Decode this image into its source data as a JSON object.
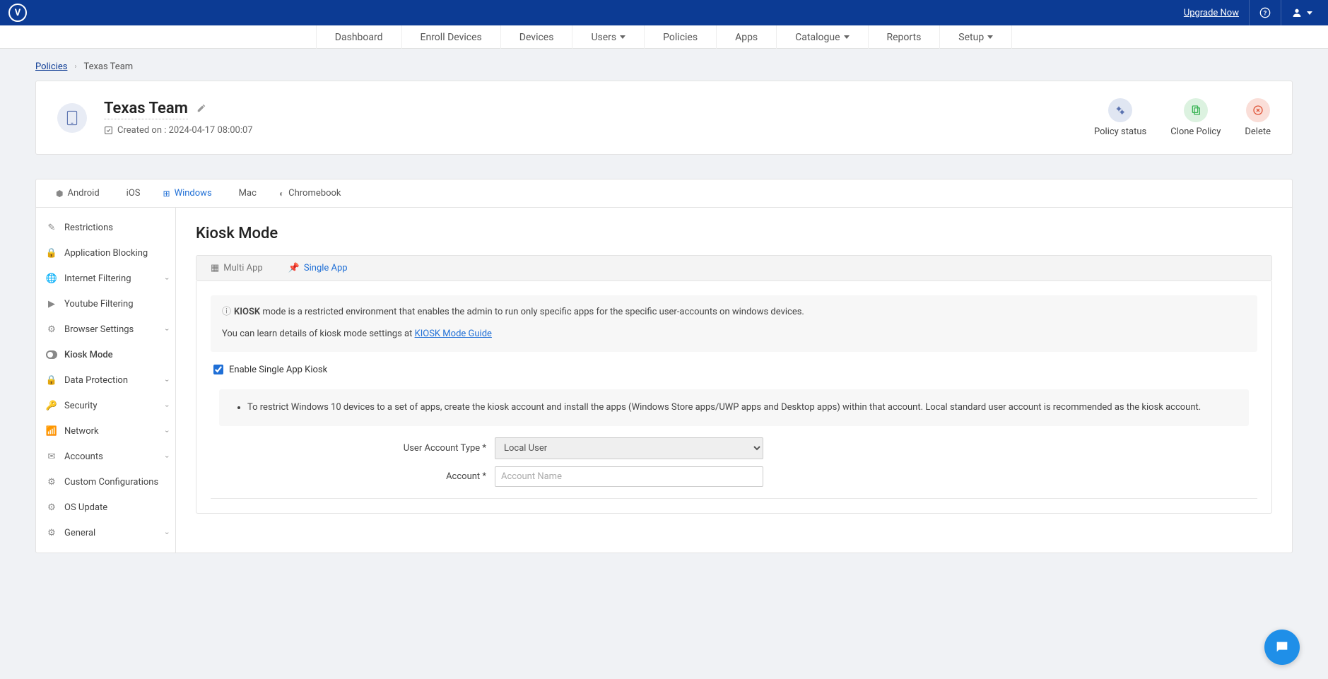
{
  "topbar": {
    "upgrade": "Upgrade Now"
  },
  "nav": {
    "dashboard": "Dashboard",
    "enroll": "Enroll Devices",
    "devices": "Devices",
    "users": "Users",
    "policies": "Policies",
    "apps": "Apps",
    "catalogue": "Catalogue",
    "reports": "Reports",
    "setup": "Setup"
  },
  "breadcrumb": {
    "root": "Policies",
    "current": "Texas Team"
  },
  "policy": {
    "title": "Texas Team",
    "created_label": "Created on : 2024-04-17 08:00:07",
    "actions": {
      "status": "Policy status",
      "clone": "Clone Policy",
      "delete": "Delete"
    }
  },
  "os_tabs": {
    "android": "Android",
    "ios": "iOS",
    "windows": "Windows",
    "mac": "Mac",
    "chromebook": "Chromebook"
  },
  "sidebar": {
    "restrictions": "Restrictions",
    "app_blocking": "Application Blocking",
    "internet_filtering": "Internet Filtering",
    "youtube_filtering": "Youtube Filtering",
    "browser_settings": "Browser Settings",
    "kiosk_mode": "Kiosk Mode",
    "data_protection": "Data Protection",
    "security": "Security",
    "network": "Network",
    "accounts": "Accounts",
    "custom_config": "Custom Configurations",
    "os_update": "OS Update",
    "general": "General"
  },
  "panel": {
    "title": "Kiosk Mode",
    "tab_multi": "Multi App",
    "tab_single": "Single App",
    "info_bold": "KIOSK",
    "info_text": " mode is a restricted environment that enables the admin to run only specific apps for the specific user-accounts on windows devices.",
    "info_learn": "You can learn details of kiosk mode settings at ",
    "info_link": "KIOSK Mode Guide",
    "enable_label": "Enable Single App Kiosk",
    "note_text": "To restrict Windows 10 devices to a set of apps, create the kiosk account and install the apps (Windows Store apps/UWP apps and Desktop apps) within that account. Local standard user account is recommended as the kiosk account.",
    "form": {
      "account_type_label": "User Account Type *",
      "account_type_value": "Local User",
      "account_label": "Account *",
      "account_placeholder": "Account Name"
    }
  }
}
